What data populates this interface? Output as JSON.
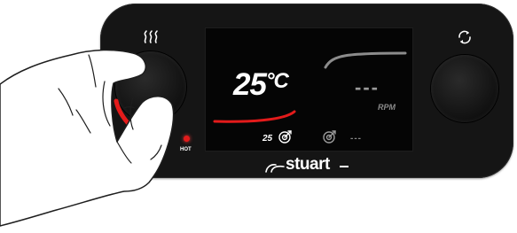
{
  "display": {
    "temperature": "25",
    "temperature_unit": "°C",
    "stir_speed": "---",
    "stir_unit": "RPM",
    "heat_setpoint": "25",
    "stir_setpoint": "---"
  },
  "indicators": {
    "hot_label": "HOT",
    "hot_color": "#e31b1b"
  },
  "brand": {
    "name": "stuart"
  },
  "colors": {
    "panel": "#151515",
    "heat_arc": "#e31b1b",
    "stir_arc": "#8c8c8c"
  },
  "icons": {
    "heat": "heat-waves-icon",
    "stir": "stir-rotate-icon",
    "target": "target-icon",
    "hand": "hand-illustration"
  }
}
